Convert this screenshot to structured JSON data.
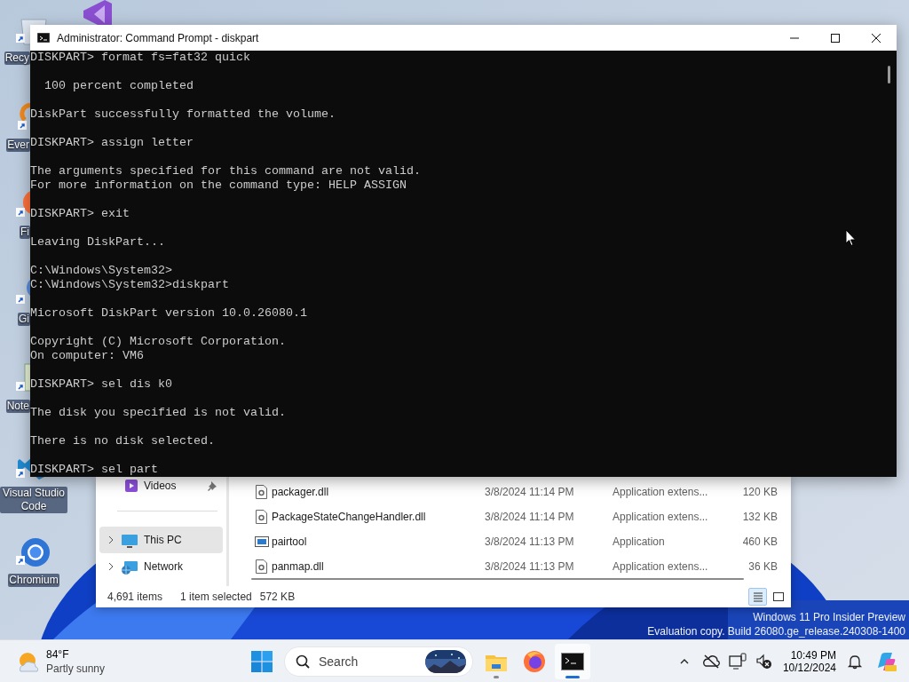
{
  "desktop": {
    "icons": [
      {
        "kind": "recycle-bin",
        "label": "Recy"
      },
      {
        "kind": "visual-studio"
      },
      {
        "kind": "everything",
        "label": "Ever"
      },
      {
        "kind": "firefox",
        "label": "Fi"
      },
      {
        "kind": "git",
        "label": "Gi"
      },
      {
        "kind": "notepad",
        "label": "Note"
      },
      {
        "kind": "vscode",
        "label": "Visual Studio Code"
      },
      {
        "kind": "chromium",
        "label": "Chromium"
      }
    ],
    "watermark": [
      "Windows 11 Pro Insider Preview",
      "Evaluation copy. Build 26080.ge_release.240308-1400"
    ]
  },
  "console_window": {
    "title": "Administrator: Command Prompt - diskpart",
    "blocks": [
      [
        "DISKPART> format fs=fat32 quick"
      ],
      [
        "  100 percent completed"
      ],
      [
        "DiskPart successfully formatted the volume."
      ],
      [
        "DISKPART> assign letter"
      ],
      [
        "The arguments specified for this command are not valid.",
        "For more information on the command type: HELP ASSIGN"
      ],
      [
        "DISKPART> exit"
      ],
      [
        "Leaving DiskPart..."
      ],
      [
        "C:\\Windows\\System32>",
        "C:\\Windows\\System32>diskpart"
      ],
      [
        "Microsoft DiskPart version 10.0.26080.1"
      ],
      [
        "Copyright (C) Microsoft Corporation.",
        "On computer: VM6"
      ],
      [
        "DISKPART> sel dis k0"
      ],
      [
        "The disk you specified is not valid."
      ],
      [
        "There is no disk selected."
      ],
      [
        "DISKPART> sel part"
      ]
    ]
  },
  "explorer_window": {
    "nav_items": [
      {
        "kind": "videos",
        "label": "Videos",
        "pinned": true,
        "selected": false
      },
      {
        "kind": "pc",
        "label": "This PC",
        "pinned": false,
        "selected": true
      },
      {
        "kind": "network",
        "label": "Network",
        "pinned": false,
        "selected": false
      }
    ],
    "files": [
      {
        "kind": "dll",
        "name": "packager.dll",
        "modified": "3/8/2024 11:14 PM",
        "type": "Application extens...",
        "size": "120 KB"
      },
      {
        "kind": "dll",
        "name": "PackageStateChangeHandler.dll",
        "modified": "3/8/2024 11:14 PM",
        "type": "Application extens...",
        "size": "132 KB"
      },
      {
        "kind": "application",
        "name": "pairtool",
        "modified": "3/8/2024 11:13 PM",
        "type": "Application",
        "size": "460 KB"
      },
      {
        "kind": "dll",
        "name": "panmap.dll",
        "modified": "3/8/2024 11:13 PM",
        "type": "Application extens...",
        "size": "36 KB"
      }
    ],
    "status": {
      "count": "4,691 items",
      "selection": "1 item selected",
      "selection_size": "572 KB"
    },
    "views": [
      {
        "kind": "details",
        "selected": true
      },
      {
        "kind": "tiles",
        "selected": false
      }
    ]
  },
  "taskbar": {
    "weather": {
      "temperature": "84°F",
      "condition": "Partly sunny"
    },
    "search": {
      "placeholder": "Search"
    },
    "apps": [
      {
        "kind": "file-explorer",
        "running": true,
        "selected": false
      },
      {
        "kind": "firefox",
        "running": false,
        "selected": false
      },
      {
        "kind": "terminal",
        "running": true,
        "selected": true
      }
    ],
    "clock": {
      "time": "10:49 PM",
      "date": "10/12/2024"
    }
  }
}
